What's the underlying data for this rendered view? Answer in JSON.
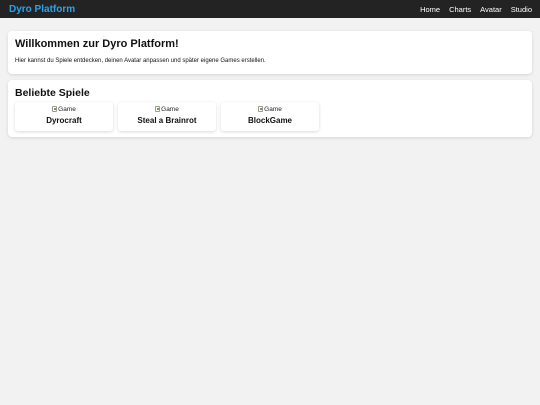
{
  "header": {
    "brand": "Dyro Platform",
    "nav": [
      "Home",
      "Charts",
      "Avatar",
      "Studio"
    ]
  },
  "welcome": {
    "title": "Willkommen zur Dyro Platform!",
    "text": "Hier kannst du Spiele entdecken, deinen Avatar anpassen und später eigene Games erstellen."
  },
  "popular": {
    "title": "Beliebte Spiele",
    "games": [
      {
        "alt": "Game",
        "title": "Dyrocraft"
      },
      {
        "alt": "Game",
        "title": "Steal a Brainrot"
      },
      {
        "alt": "Game",
        "title": "BlockGame"
      }
    ]
  },
  "colors": {
    "header_bg": "#232323",
    "brand": "#2aa3ea",
    "page_bg": "#f2f2f2"
  }
}
